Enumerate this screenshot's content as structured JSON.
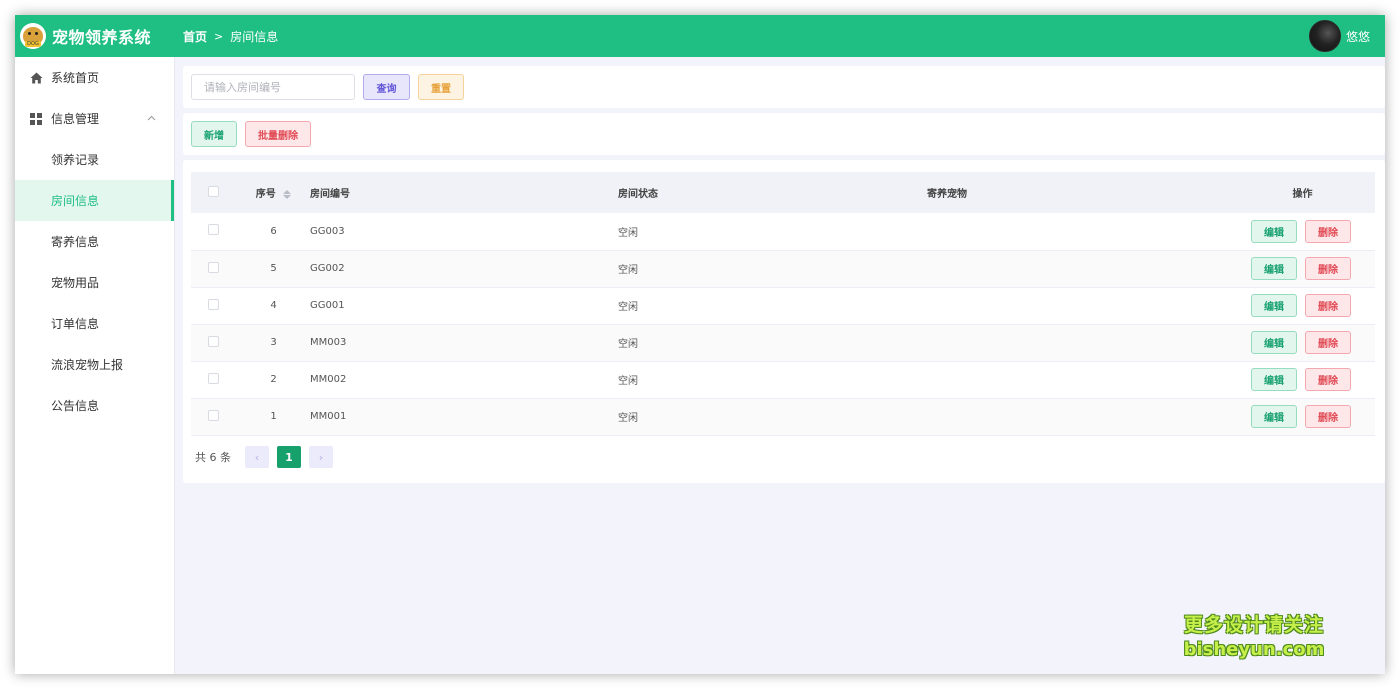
{
  "app": {
    "title": "宠物领养系统",
    "logo_tag": "DOG"
  },
  "header": {
    "breadcrumb_home": "首页",
    "breadcrumb_separator": ">",
    "breadcrumb_current": "房间信息",
    "username": "悠悠"
  },
  "sidebar": {
    "items": [
      {
        "label": "系统首页",
        "icon": "home-icon"
      },
      {
        "label": "信息管理",
        "icon": "grid-icon",
        "expanded": true
      },
      {
        "label": "领养记录"
      },
      {
        "label": "房间信息",
        "active": true
      },
      {
        "label": "寄养信息"
      },
      {
        "label": "宠物用品"
      },
      {
        "label": "订单信息"
      },
      {
        "label": "流浪宠物上报"
      },
      {
        "label": "公告信息"
      }
    ],
    "expand_icon": "^"
  },
  "search": {
    "placeholder": "请输入房间编号",
    "value": "",
    "query_label": "查询",
    "reset_label": "重置"
  },
  "actions": {
    "add_label": "新增",
    "batch_delete_label": "批量删除"
  },
  "table": {
    "headers": {
      "seq": "序号",
      "room_no": "房间编号",
      "room_status": "房间状态",
      "foster_pet": "寄养宠物",
      "operation": "操作"
    },
    "rows": [
      {
        "seq": "6",
        "room_no": "GG003",
        "status": "空闲",
        "pet": ""
      },
      {
        "seq": "5",
        "room_no": "GG002",
        "status": "空闲",
        "pet": ""
      },
      {
        "seq": "4",
        "room_no": "GG001",
        "status": "空闲",
        "pet": ""
      },
      {
        "seq": "3",
        "room_no": "MM003",
        "status": "空闲",
        "pet": ""
      },
      {
        "seq": "2",
        "room_no": "MM002",
        "status": "空闲",
        "pet": ""
      },
      {
        "seq": "1",
        "room_no": "MM001",
        "status": "空闲",
        "pet": ""
      }
    ],
    "edit_label": "编辑",
    "delete_label": "删除"
  },
  "pagination": {
    "total_text": "共 6 条",
    "current_page": "1",
    "prev": "‹",
    "next": "›"
  },
  "watermark": {
    "line1": "更多设计请关注",
    "line2": "bisheyun.com"
  },
  "colors": {
    "brand": "#1fbf84",
    "active_bg": "#e4f7ef",
    "danger": "#e14b55",
    "warning": "#e8a23c",
    "primary": "#6558d8"
  }
}
